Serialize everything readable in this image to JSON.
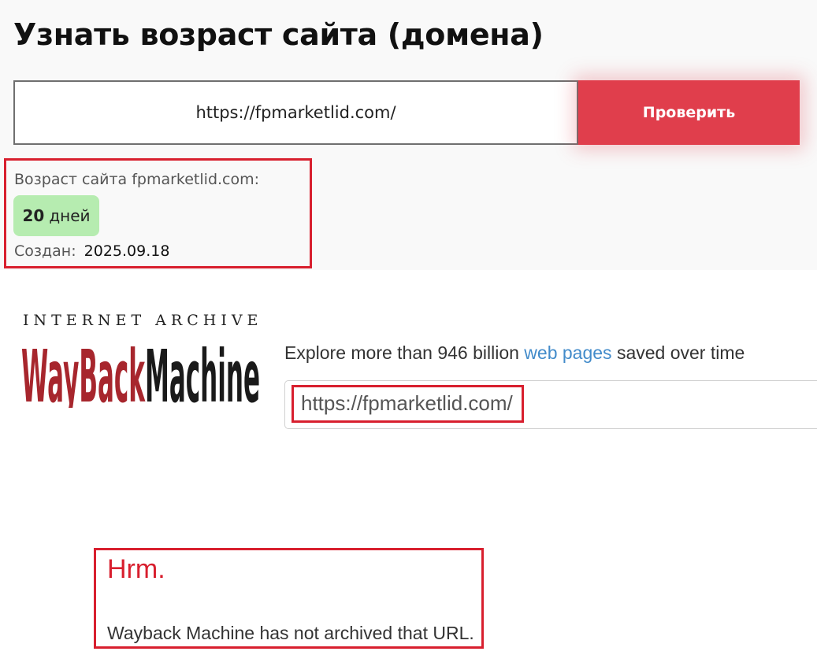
{
  "age_checker": {
    "title": "Узнать возраст сайта (домена)",
    "url_value": "https://fpmarketlid.com/",
    "check_button": "Проверить",
    "result_label": "Возраст сайта fpmarketlid.com:",
    "age_number": "20",
    "age_unit": "дней",
    "created_label": "Создан:",
    "created_date": "2025.09.18",
    "accent_color": "#e03e4c",
    "badge_color": "#b6ecb0"
  },
  "wayback": {
    "brand_top": "INTERNET ARCHIVE",
    "brand_logo": "WayBackMachine",
    "explore_prefix": "Explore more than 946 billion",
    "explore_link": "web pages",
    "explore_suffix": "saved over time",
    "search_value": "https://fpmarketlid.com/",
    "error_title": "Hrm.",
    "error_message": "Wayback Machine has not archived that URL.",
    "logo_colors": {
      "red": "#a7262d",
      "black": "#1a1a1a"
    }
  },
  "highlight_color": "#d81f2e"
}
